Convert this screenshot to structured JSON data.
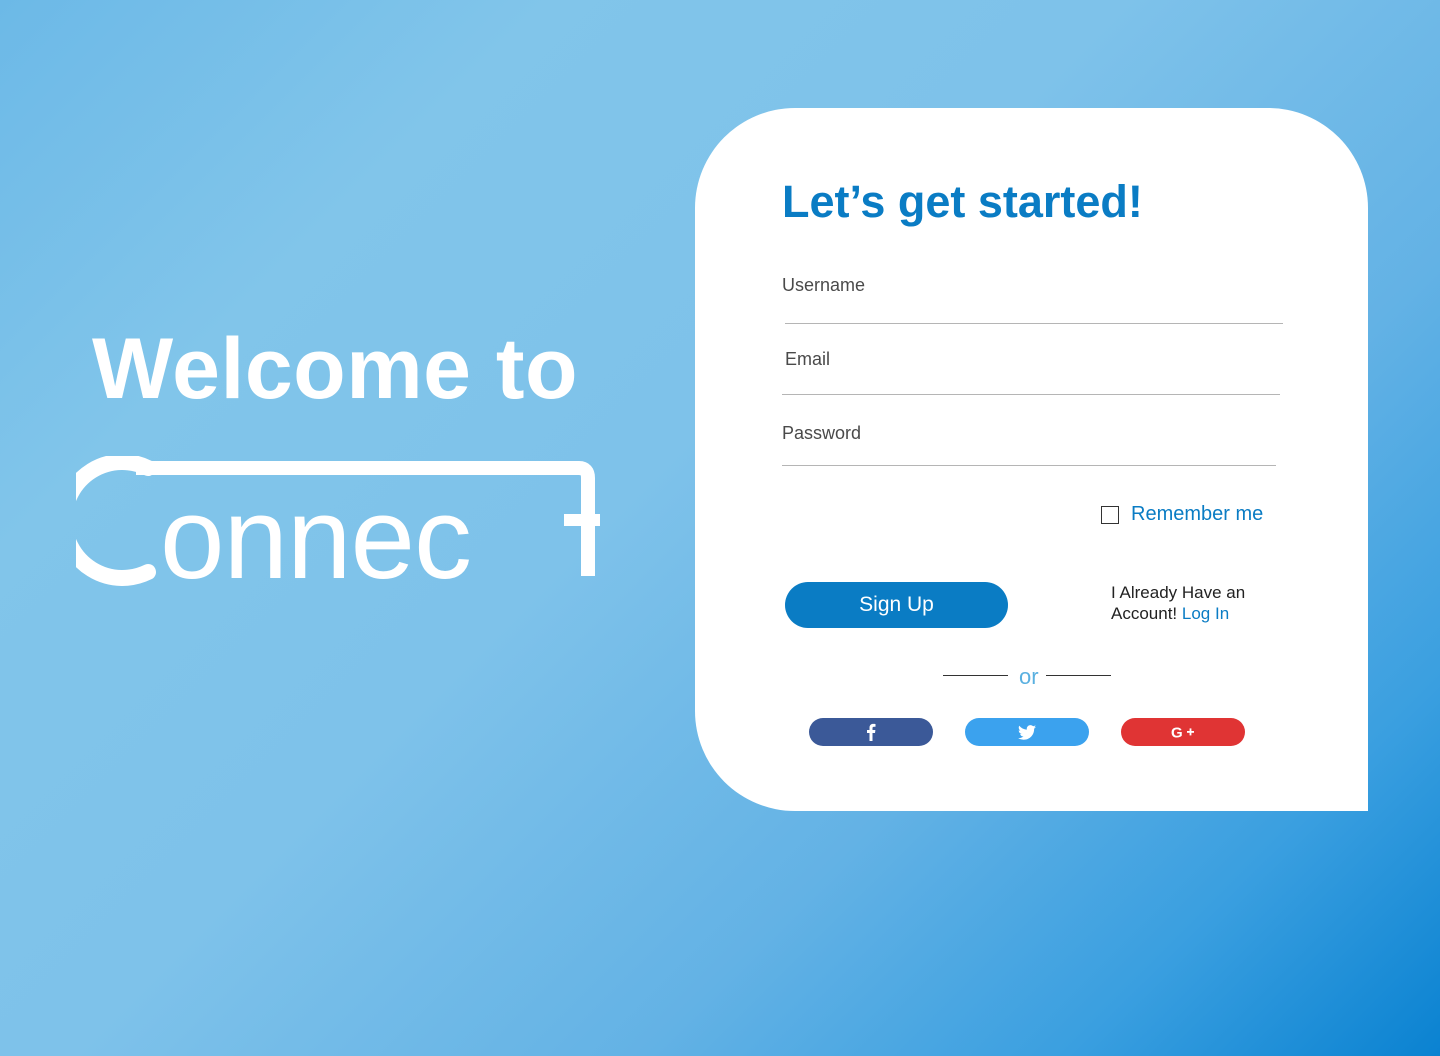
{
  "welcome": {
    "heading": "Welcome to",
    "logo_text": "Connect"
  },
  "form": {
    "title": "Let’s get started!",
    "username_label": "Username",
    "email_label": "Email",
    "password_label": "Password",
    "remember_label": "Remember me",
    "signup_label": "Sign Up",
    "already_text": "I Already Have an Account!",
    "login_label": "Log In",
    "or_label": "or"
  },
  "social": [
    {
      "name": "facebook",
      "icon": "facebook-icon",
      "color": "#3b5998"
    },
    {
      "name": "twitter",
      "icon": "twitter-icon",
      "color": "#3ba2ee"
    },
    {
      "name": "google-plus",
      "icon": "google-plus-icon",
      "color": "#e03434"
    }
  ],
  "colors": {
    "accent": "#0a7cc4",
    "background_start": "#6cb9e7",
    "background_end": "#0a82d1"
  }
}
